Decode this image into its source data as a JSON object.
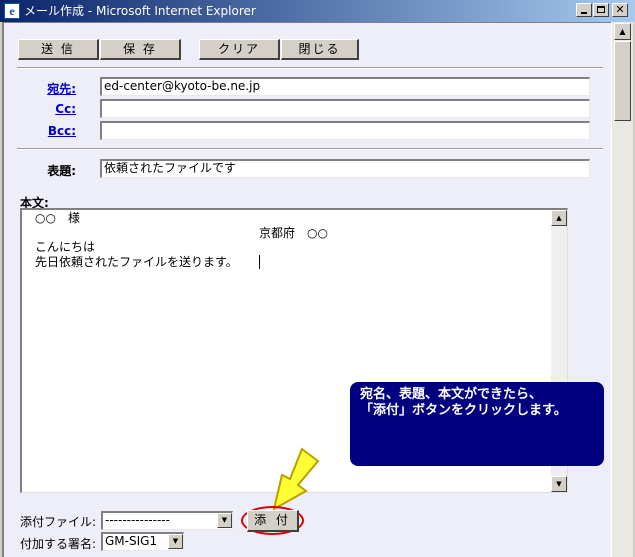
{
  "window": {
    "title": "メール作成 - Microsoft Internet Explorer",
    "icon": "ie-icon",
    "controls": {
      "minimize": "minimize-icon",
      "maximize": "maximize-icon",
      "close": "✕"
    }
  },
  "toolbar": {
    "send_label": "送 信",
    "save_label": "保 存",
    "clear_label": "クリア",
    "close_label": "閉じる"
  },
  "recipients": {
    "to_label": "宛先:",
    "to_value": "ed-center@kyoto-be.ne.jp",
    "cc_label": "Cc:",
    "cc_value": "",
    "bcc_label": "Bcc:",
    "bcc_value": ""
  },
  "subject": {
    "label": "表題:",
    "value": "依頼されたファイルです"
  },
  "body": {
    "label": "本文:",
    "lines": [
      "○○　様",
      "京都府　○○",
      "こんにちは",
      "先日依頼されたファイルを送ります。"
    ]
  },
  "callout": {
    "line1": "宛名、表題、本文ができたら、",
    "line2": "「添付」ボタンをクリックします。"
  },
  "attachment": {
    "label": "添付ファイル:",
    "selected": "---------------",
    "button_label": "添 付"
  },
  "signature": {
    "label": "付加する署名:",
    "selected": "GM-SIG1"
  },
  "colors": {
    "callout_bg": "#000080",
    "arrow": "#ffff33",
    "highlight_ring": "#e00000",
    "link": "#0000cc"
  }
}
